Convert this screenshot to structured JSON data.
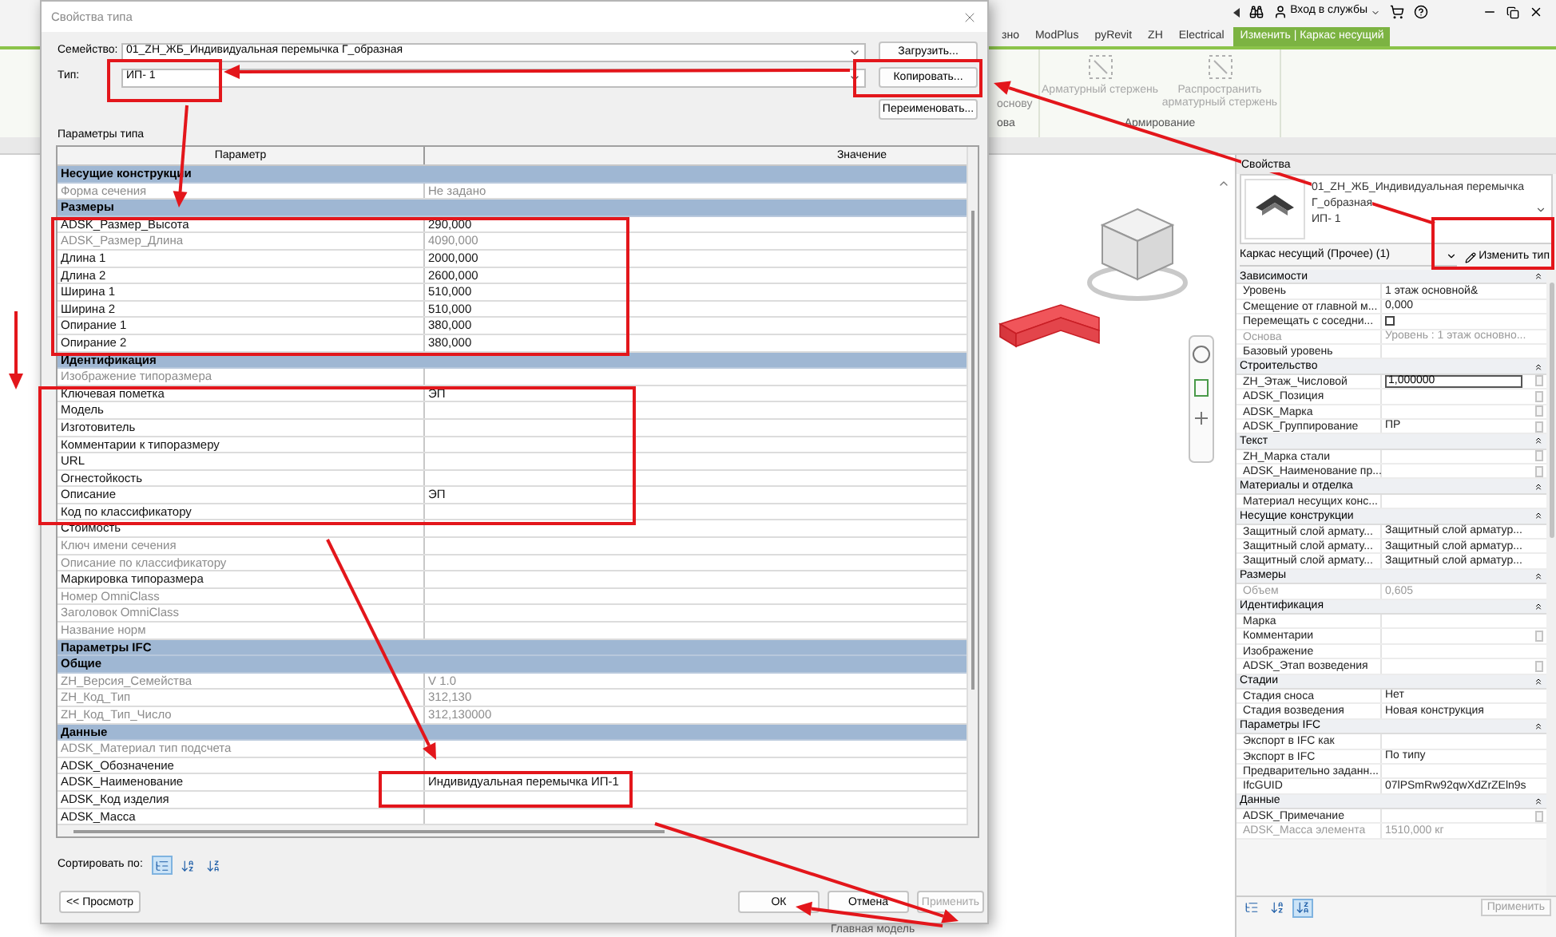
{
  "app": {
    "login_label": "Вход в службы",
    "tabs": [
      {
        "label": "зно",
        "selected": false
      },
      {
        "label": "ModPlus",
        "selected": false
      },
      {
        "label": "pyRevit",
        "selected": false
      },
      {
        "label": "ZH",
        "selected": false
      },
      {
        "label": "Electrical",
        "selected": false
      },
      {
        "label": "Изменить | Каркас несущий",
        "selected": true
      }
    ],
    "ribbon": {
      "partial_button": "основу",
      "partial_panel": "ова",
      "buttons": [
        "Арматурный стержень",
        "Распространить арматурный стержень"
      ],
      "panel_label": "Армирование"
    },
    "status_text": "Главная модель",
    "properties": {
      "title": "Свойства",
      "type_family": "01_ZH_ЖБ_Индивидуальная перемычка",
      "type_family_2": "Г_образная",
      "type_name": "ИП- 1",
      "category": "Каркас несущий (Прочее) (1)",
      "edit_type_button": "Изменить тип",
      "rows": [
        {
          "kind": "group",
          "label": "Зависимости"
        },
        {
          "kind": "param",
          "name": "Уровень",
          "value": "1 этаж основной&",
          "disabled": false,
          "has_link": false
        },
        {
          "kind": "param",
          "name": "Смещение от главной м...",
          "value": "0,000",
          "disabled": false,
          "has_link": false
        },
        {
          "kind": "checkbox",
          "name": "Перемещать с соседни...",
          "checked": false
        },
        {
          "kind": "param",
          "name": "Основа",
          "value": "Уровень : 1 этаж основно...",
          "disabled": true,
          "has_link": false
        },
        {
          "kind": "param",
          "name": "Базовый уровень",
          "disabled": false,
          "has_link": false
        },
        {
          "kind": "group",
          "label": "Строительство"
        },
        {
          "kind": "input",
          "name": "ZH_Этаж_Числовой",
          "value": "1,000000",
          "has_link": true
        },
        {
          "kind": "param",
          "name": "ADSK_Позиция",
          "disabled": false,
          "has_link": true
        },
        {
          "kind": "param",
          "name": "ADSK_Марка",
          "disabled": false,
          "has_link": true
        },
        {
          "kind": "param",
          "name": "ADSK_Группирование",
          "value": "ПР",
          "disabled": false,
          "has_link": true
        },
        {
          "kind": "group",
          "label": "Текст"
        },
        {
          "kind": "param",
          "name": "ZH_Марка стали",
          "disabled": false,
          "has_link": true
        },
        {
          "kind": "param",
          "name": "ADSK_Наименование пр...",
          "disabled": false,
          "has_link": true
        },
        {
          "kind": "group",
          "label": "Материалы и отделка"
        },
        {
          "kind": "param",
          "name": "Материал несущих конс...",
          "disabled": false,
          "has_link": false
        },
        {
          "kind": "group",
          "label": "Несущие конструкции"
        },
        {
          "kind": "param",
          "name": "Защитный слой армату...",
          "value": "Защитный слой арматур...",
          "disabled": false,
          "has_link": false
        },
        {
          "kind": "param",
          "name": "Защитный слой армату...",
          "value": "Защитный слой арматур...",
          "disabled": false,
          "has_link": false
        },
        {
          "kind": "param",
          "name": "Защитный слой армату...",
          "value": "Защитный слой арматур...",
          "disabled": false,
          "has_link": false
        },
        {
          "kind": "group",
          "label": "Размеры"
        },
        {
          "kind": "param",
          "name": "Объем",
          "value": "0,605",
          "disabled": true,
          "has_link": false
        },
        {
          "kind": "group",
          "label": "Идентификация"
        },
        {
          "kind": "param",
          "name": "Марка",
          "disabled": false,
          "has_link": false
        },
        {
          "kind": "param",
          "name": "Комментарии",
          "disabled": false,
          "has_link": true
        },
        {
          "kind": "param",
          "name": "Изображение",
          "disabled": false,
          "has_link": false
        },
        {
          "kind": "param",
          "name": "ADSK_Этап возведения",
          "disabled": false,
          "has_link": true
        },
        {
          "kind": "group",
          "label": "Стадии"
        },
        {
          "kind": "param",
          "name": "Стадия сноса",
          "value": "Нет",
          "disabled": false,
          "has_link": false
        },
        {
          "kind": "param",
          "name": "Стадия возведения",
          "value": "Новая конструкция",
          "disabled": false,
          "has_link": false
        },
        {
          "kind": "group",
          "label": "Параметры IFC"
        },
        {
          "kind": "param",
          "name": "Экспорт в IFC как",
          "disabled": false,
          "has_link": false
        },
        {
          "kind": "param",
          "name": "Экспорт в IFC",
          "value": "По типу",
          "disabled": false,
          "has_link": false
        },
        {
          "kind": "param",
          "name": "Предварительно заданн...",
          "disabled": false,
          "has_link": false
        },
        {
          "kind": "param",
          "name": "IfcGUID",
          "value": "07lPSmRw92qwXdZrZEln9s",
          "disabled": false,
          "has_link": false
        },
        {
          "kind": "group",
          "label": "Данные"
        },
        {
          "kind": "param",
          "name": "ADSK_Примечание",
          "disabled": false,
          "has_link": true
        },
        {
          "kind": "param",
          "name": "ADSK_Масса элемента",
          "value": "1510,000 кг",
          "disabled": true,
          "has_link": false
        }
      ],
      "sort_options": [
        {
          "selected": false
        },
        {
          "selected": false
        },
        {
          "selected": true
        }
      ],
      "apply_button": {
        "label": "Применить",
        "disabled": true
      }
    }
  },
  "dialog": {
    "title": "Свойства типа",
    "family_label": "Семейство:",
    "family_value": "01_ZH_ЖБ_Индивидуальная перемычка Г_образная",
    "load_button": "Загрузить...",
    "type_label": "Тип:",
    "type_value": "ИП- 1",
    "copy_button": "Копировать...",
    "rename_button": "Переименовать...",
    "section_label": "Параметры типа",
    "table": {
      "columns": [
        "Параметр",
        "Значение"
      ],
      "rows": [
        {
          "kind": "group",
          "label": "Несущие конструкции"
        },
        {
          "kind": "param",
          "name": "Форма сечения",
          "value": "Не задано",
          "disabled": true
        },
        {
          "kind": "group",
          "label": "Размеры"
        },
        {
          "kind": "param",
          "name": "ADSK_Размер_Высота",
          "value": "290,000",
          "disabled": false
        },
        {
          "kind": "param",
          "name": "ADSK_Размер_Длина",
          "value": "4090,000",
          "disabled": true
        },
        {
          "kind": "param",
          "name": "Длина 1",
          "value": "2000,000",
          "disabled": false
        },
        {
          "kind": "param",
          "name": "Длина 2",
          "value": "2600,000",
          "disabled": false
        },
        {
          "kind": "param",
          "name": "Ширина 1",
          "value": "510,000",
          "disabled": false
        },
        {
          "kind": "param",
          "name": "Ширина 2",
          "value": "510,000",
          "disabled": false
        },
        {
          "kind": "param",
          "name": "Опирание 1",
          "value": "380,000",
          "disabled": false
        },
        {
          "kind": "param",
          "name": "Опирание 2",
          "value": "380,000",
          "disabled": false
        },
        {
          "kind": "group",
          "label": "Идентификация"
        },
        {
          "kind": "param",
          "name": "Изображение типоразмера",
          "disabled": true
        },
        {
          "kind": "param",
          "name": "Ключевая пометка",
          "value": "ЭП",
          "disabled": false
        },
        {
          "kind": "param",
          "name": "Модель",
          "disabled": false
        },
        {
          "kind": "param",
          "name": "Изготовитель",
          "disabled": false
        },
        {
          "kind": "param",
          "name": "Комментарии к типоразмеру",
          "disabled": false
        },
        {
          "kind": "param",
          "name": "URL",
          "disabled": false
        },
        {
          "kind": "param",
          "name": "Огнестойкость",
          "disabled": false
        },
        {
          "kind": "param",
          "name": "Описание",
          "value": "ЭП",
          "disabled": false
        },
        {
          "kind": "param",
          "name": "Код по классификатору",
          "disabled": false
        },
        {
          "kind": "param",
          "name": "Стоимость",
          "disabled": false
        },
        {
          "kind": "param",
          "name": "Ключ имени сечения",
          "disabled": true
        },
        {
          "kind": "param",
          "name": "Описание по классификатору",
          "disabled": true
        },
        {
          "kind": "param",
          "name": "Маркировка типоразмера",
          "disabled": false
        },
        {
          "kind": "param",
          "name": "Номер OmniClass",
          "disabled": true
        },
        {
          "kind": "param",
          "name": "Заголовок OmniClass",
          "disabled": true
        },
        {
          "kind": "param",
          "name": "Название норм",
          "disabled": true
        },
        {
          "kind": "group",
          "label": "Параметры IFC"
        },
        {
          "kind": "group",
          "label": "Общие"
        },
        {
          "kind": "param",
          "name": "ZH_Версия_Семейства",
          "value": "V 1.0",
          "disabled": true
        },
        {
          "kind": "param",
          "name": "ZH_Код_Тип",
          "value": "312,130",
          "disabled": true
        },
        {
          "kind": "param",
          "name": "ZH_Код_Тип_Число",
          "value": "312,130000",
          "disabled": true
        },
        {
          "kind": "group",
          "label": "Данные"
        },
        {
          "kind": "param",
          "name": "ADSK_Материал тип подсчета",
          "disabled": true
        },
        {
          "kind": "param",
          "name": "ADSK_Обозначение",
          "disabled": false
        },
        {
          "kind": "param",
          "name": "ADSK_Наименование",
          "value": "Индивидуальная перемычка ИП-1",
          "disabled": false
        },
        {
          "kind": "param",
          "name": "ADSK_Код изделия",
          "disabled": false
        },
        {
          "kind": "param",
          "name": "ADSK_Масса",
          "disabled": false
        }
      ]
    },
    "sort_label": "Сортировать по:",
    "sort_options": [
      {
        "selected": true
      },
      {
        "selected": false
      },
      {
        "selected": false
      }
    ],
    "preview_button": "<< Просмотр",
    "ok_button": "ОК",
    "cancel_button": "Отмена",
    "apply_button": {
      "label": "Применить",
      "disabled": true
    }
  }
}
